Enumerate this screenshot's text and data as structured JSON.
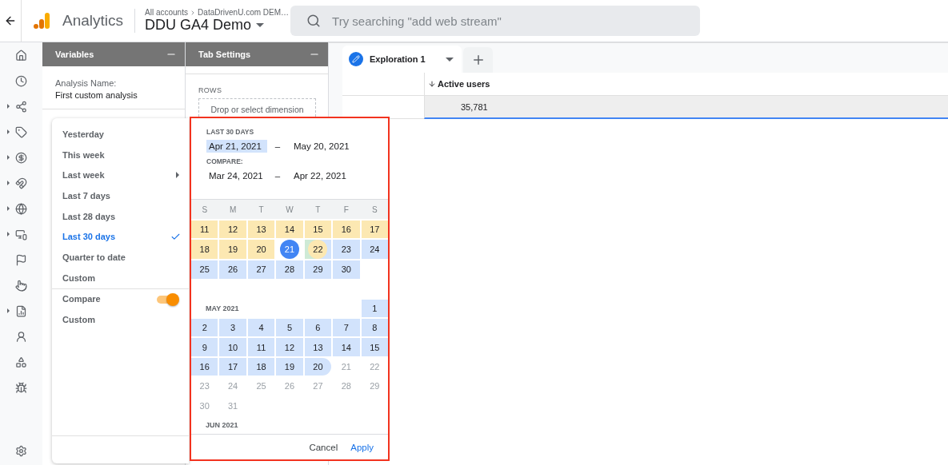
{
  "header": {
    "product": "Analytics",
    "breadcrumb": [
      "All accounts",
      "DataDrivenU.com DEM…"
    ],
    "property": "DDU GA4 Demo",
    "search": {
      "placeholder": "Try searching \"add web stream\""
    }
  },
  "nav": [
    {
      "expandable": false
    },
    {
      "expandable": false
    },
    {
      "expandable": true
    },
    {
      "expandable": true
    },
    {
      "expandable": true
    },
    {
      "expandable": true
    },
    {
      "expandable": true
    },
    {
      "expandable": true
    },
    {
      "expandable": false
    },
    {
      "expandable": false
    },
    {
      "expandable": true
    },
    {
      "expandable": false
    },
    {
      "expandable": false
    },
    {
      "expandable": false
    }
  ],
  "variables": {
    "title": "Variables",
    "name_label": "Analysis Name:",
    "name_value": "First custom analysis"
  },
  "tab_settings": {
    "title": "Tab Settings",
    "rows_label": "ROWS",
    "drop_zone": "Drop or select dimension"
  },
  "tabs": [
    {
      "label": "Exploration 1",
      "selected": true
    }
  ],
  "table": {
    "column": "Active users",
    "value": "35,781"
  },
  "date_menu": {
    "groups": [
      [
        {
          "kind": "option",
          "label": "Yesterday",
          "selected": false,
          "submenu": false
        },
        {
          "kind": "option",
          "label": "This week",
          "selected": false,
          "submenu": false
        },
        {
          "kind": "option",
          "label": "Last week",
          "selected": false,
          "submenu": true
        },
        {
          "kind": "option",
          "label": "Last 7 days",
          "selected": false,
          "submenu": false
        },
        {
          "kind": "option",
          "label": "Last 28 days",
          "selected": false,
          "submenu": false
        },
        {
          "kind": "option",
          "label": "Last 30 days",
          "selected": true,
          "submenu": false
        },
        {
          "kind": "option",
          "label": "Quarter to date",
          "selected": false,
          "submenu": false
        },
        {
          "kind": "option",
          "label": "Custom",
          "selected": false,
          "submenu": false
        }
      ],
      [
        {
          "kind": "toggle",
          "label": "Compare",
          "on": true
        },
        {
          "kind": "option",
          "label": "Custom",
          "selected": false,
          "submenu": false
        }
      ]
    ]
  },
  "calendar": {
    "range_label": "LAST 30 DAYS",
    "range": [
      {
        "value": "Apr 21, 2021",
        "selected": true
      },
      {
        "value": "May 20, 2021",
        "selected": false
      }
    ],
    "compare_label": "COMPARE:",
    "compare": [
      {
        "value": "Mar 24, 2021",
        "selected": false
      },
      {
        "value": "Apr 22, 2021",
        "selected": false
      }
    ],
    "separator": "–",
    "weekdays": [
      "S",
      "M",
      "T",
      "W",
      "T",
      "F",
      "S"
    ],
    "months": [
      {
        "weeks": [
          [
            {
              "day": "11",
              "kind": "compare"
            },
            {
              "day": "12",
              "kind": "compare"
            },
            {
              "day": "13",
              "kind": "compare"
            },
            {
              "day": "14",
              "kind": "compare"
            },
            {
              "day": "15",
              "kind": "compare"
            },
            {
              "day": "16",
              "kind": "compare"
            },
            {
              "day": "17",
              "kind": "compare"
            }
          ],
          [
            {
              "day": "18",
              "kind": "compare"
            },
            {
              "day": "19",
              "kind": "compare"
            },
            {
              "day": "20",
              "kind": "compare"
            },
            {
              "day": "21",
              "kind": "start"
            },
            {
              "day": "22",
              "kind": "overlap"
            },
            {
              "day": "23",
              "kind": "current"
            },
            {
              "day": "24",
              "kind": "current"
            }
          ],
          [
            {
              "day": "25",
              "kind": "current"
            },
            {
              "day": "26",
              "kind": "current"
            },
            {
              "day": "27",
              "kind": "current"
            },
            {
              "day": "28",
              "kind": "current"
            },
            {
              "day": "29",
              "kind": "current"
            },
            {
              "day": "30",
              "kind": "current"
            },
            {
              "kind": "blank"
            }
          ]
        ]
      },
      {
        "label": "MAY 2021",
        "weeks": [
          [
            {
              "kind": "blank"
            },
            {
              "kind": "blank"
            },
            {
              "kind": "blank"
            },
            {
              "kind": "blank"
            },
            {
              "kind": "blank"
            },
            {
              "kind": "blank"
            },
            {
              "day": "1",
              "kind": "current"
            }
          ],
          [
            {
              "day": "2",
              "kind": "current"
            },
            {
              "day": "3",
              "kind": "current"
            },
            {
              "day": "4",
              "kind": "current"
            },
            {
              "day": "5",
              "kind": "current"
            },
            {
              "day": "6",
              "kind": "current"
            },
            {
              "day": "7",
              "kind": "current"
            },
            {
              "day": "8",
              "kind": "current"
            }
          ],
          [
            {
              "day": "9",
              "kind": "current"
            },
            {
              "day": "10",
              "kind": "current"
            },
            {
              "day": "11",
              "kind": "current"
            },
            {
              "day": "12",
              "kind": "current"
            },
            {
              "day": "13",
              "kind": "current"
            },
            {
              "day": "14",
              "kind": "current"
            },
            {
              "day": "15",
              "kind": "current"
            }
          ],
          [
            {
              "day": "16",
              "kind": "current"
            },
            {
              "day": "17",
              "kind": "current"
            },
            {
              "day": "18",
              "kind": "current"
            },
            {
              "day": "19",
              "kind": "current"
            },
            {
              "day": "20",
              "kind": "end"
            },
            {
              "day": "21",
              "kind": "out"
            },
            {
              "day": "22",
              "kind": "out"
            }
          ],
          [
            {
              "day": "23",
              "kind": "out"
            },
            {
              "day": "24",
              "kind": "out"
            },
            {
              "day": "25",
              "kind": "out"
            },
            {
              "day": "26",
              "kind": "out"
            },
            {
              "day": "27",
              "kind": "out"
            },
            {
              "day": "28",
              "kind": "out"
            },
            {
              "day": "29",
              "kind": "out"
            }
          ],
          [
            {
              "day": "30",
              "kind": "out"
            },
            {
              "day": "31",
              "kind": "out"
            },
            {
              "kind": "blank"
            },
            {
              "kind": "blank"
            },
            {
              "kind": "blank"
            },
            {
              "kind": "blank"
            },
            {
              "kind": "blank"
            }
          ]
        ]
      },
      {
        "label": "JUN 2021"
      }
    ],
    "buttons": [
      {
        "label": "Cancel",
        "kind": "secondary"
      },
      {
        "label": "Apply",
        "kind": "primary"
      }
    ]
  }
}
